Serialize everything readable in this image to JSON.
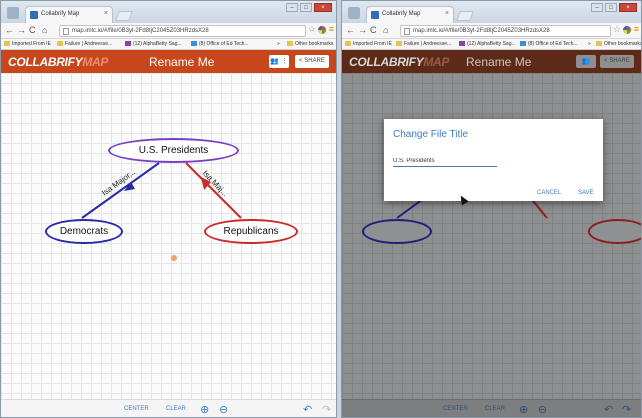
{
  "browser": {
    "tab_title": "Collabrify Map",
    "tab_close": "×",
    "url": "map.imlc.io/#/file/0B3yl-2Fd8IjC2045Z03HRzdsX28",
    "bookmarks": [
      "Imported From IE",
      "Failure | Andreesse...",
      "(12) AlphaBetty Sag...",
      "(8) Office of Ed Tech...",
      "Other bookmarks"
    ],
    "bookmarks_overflow": "»"
  },
  "app": {
    "logo_main": "COLLABRIFY",
    "logo_map": "MAP",
    "doc_title": "Rename Me",
    "share_label": "SHARE",
    "collab_icon": "people-icon"
  },
  "map": {
    "root_node": "U.S. Presidents",
    "left_node": "Democrats",
    "right_node": "Republicans",
    "left_edge_label": "Isa Major...",
    "right_edge_label": "Isa Maj..."
  },
  "footer": {
    "center": "CENTER",
    "clear": "CLEAR"
  },
  "dialog": {
    "title": "Change File Title",
    "input_value": "U.S. Presidents",
    "cancel": "CANCEL",
    "save": "SAVE"
  },
  "colors": {
    "appbar": "#c7461c",
    "root": "#7b3fc4",
    "democrats": "#2a2aa8",
    "republicans": "#cc2a2a",
    "accent": "#3d7bc2"
  }
}
